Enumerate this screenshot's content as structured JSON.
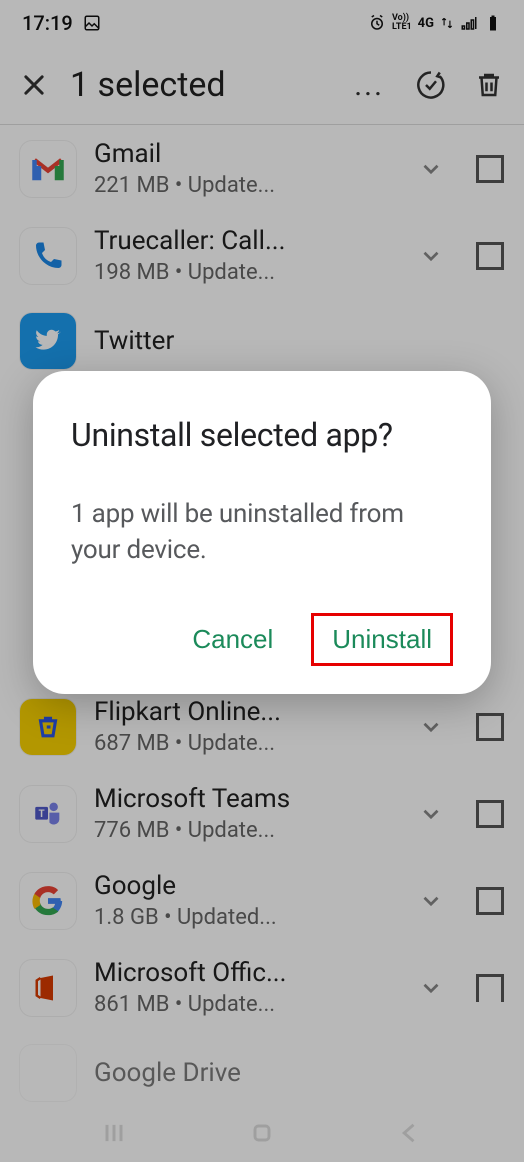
{
  "status": {
    "time": "17:19",
    "net_label1": "Vo))",
    "net_label2": "LTE1",
    "net_4g": "4G"
  },
  "header": {
    "title": "1 selected"
  },
  "apps": [
    {
      "name": "Gmail",
      "sub": "221 MB   •   Update..."
    },
    {
      "name": "Truecaller: Call...",
      "sub": "198 MB   •   Update..."
    },
    {
      "name": "Twitter",
      "sub": ""
    },
    {
      "name": "Flipkart Online...",
      "sub": "687 MB   •   Update..."
    },
    {
      "name": "Microsoft Teams",
      "sub": "776 MB   •   Update..."
    },
    {
      "name": "Google",
      "sub": "1.8 GB   •   Updated..."
    },
    {
      "name": "Microsoft Offic...",
      "sub": "861 MB   •   Update..."
    },
    {
      "name": "Google Drive",
      "sub": ""
    }
  ],
  "dialog": {
    "title": "Uninstall selected app?",
    "body": "1 app will be uninstalled from your device.",
    "cancel": "Cancel",
    "confirm": "Uninstall"
  }
}
